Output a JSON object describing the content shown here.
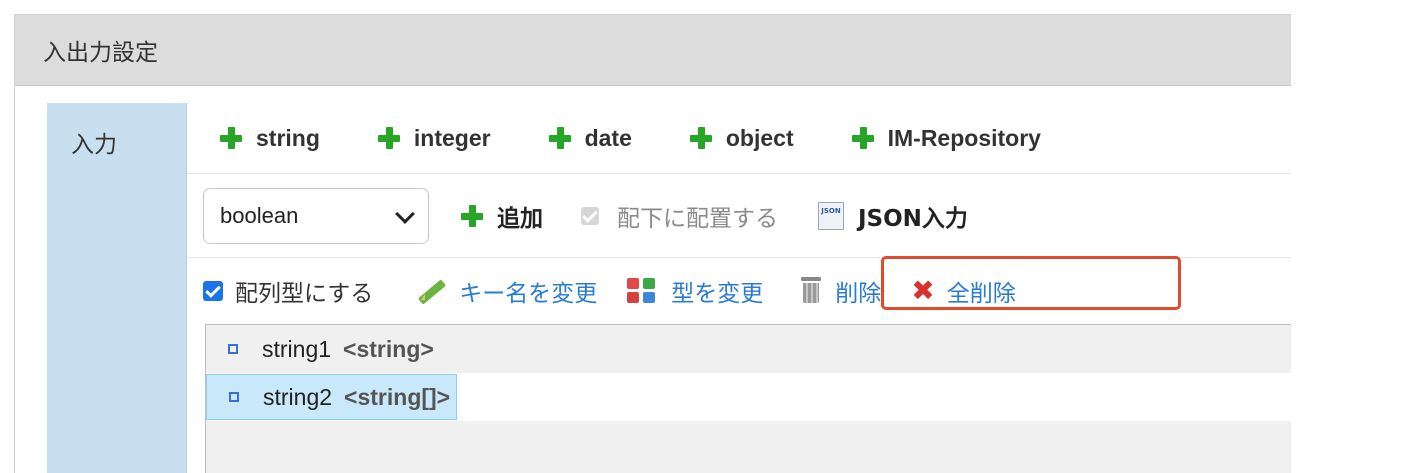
{
  "panel": {
    "title": "入出力設定"
  },
  "section": {
    "label": "入力"
  },
  "type_buttons": [
    {
      "label": "string",
      "icon": "plus-icon"
    },
    {
      "label": "integer",
      "icon": "plus-icon"
    },
    {
      "label": "date",
      "icon": "plus-icon"
    },
    {
      "label": "object",
      "icon": "plus-icon"
    },
    {
      "label": "IM-Repository",
      "icon": "plus-icon"
    }
  ],
  "type_select": {
    "value": "boolean"
  },
  "add_button": {
    "label": "追加"
  },
  "place_under": {
    "label": "配下に配置する",
    "checked": true,
    "disabled": true
  },
  "json_input": {
    "label": "JSON入力",
    "icon_text": "JSON"
  },
  "array_checkbox": {
    "label": "配列型にする",
    "checked": true
  },
  "actions": {
    "rename": "キー名を変更",
    "change_type": "型を変更",
    "delete": "削除",
    "delete_all": "全削除"
  },
  "tree": [
    {
      "name": "string1",
      "type": "<string>"
    },
    {
      "name": "string2",
      "type": "<string[]>",
      "selected": true
    }
  ],
  "colors": {
    "accent_green": "#27a527",
    "link_blue": "#2a7bd3",
    "highlight_red": "#e14a2a",
    "label_bg": "#c7dfee"
  }
}
